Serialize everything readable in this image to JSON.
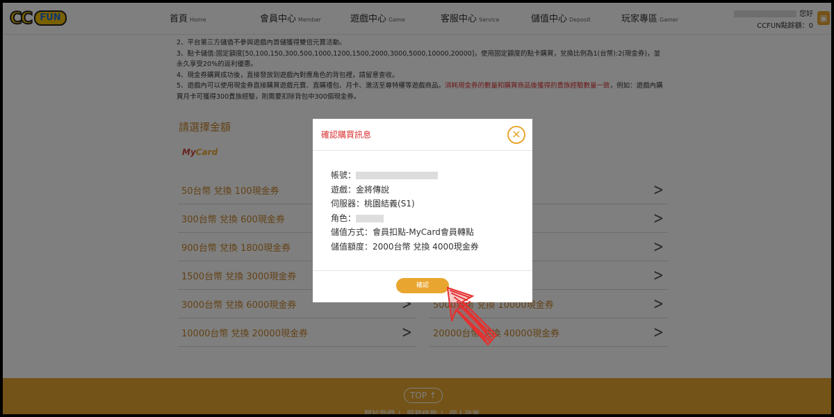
{
  "header": {
    "logo_cc": "CC",
    "logo_fun": "FUN",
    "nav": [
      {
        "zh": "首頁",
        "en": "Home"
      },
      {
        "zh": "會員中心",
        "en": "Member"
      },
      {
        "zh": "遊戲中心",
        "en": "Game"
      },
      {
        "zh": "客服中心",
        "en": "Service"
      },
      {
        "zh": "儲值中心",
        "en": "Deposit"
      },
      {
        "zh": "玩家專區",
        "en": "Gamer"
      }
    ],
    "greeting": "您好",
    "points": "CCFUN點餘額：0"
  },
  "notes": {
    "line2": "2、平台第三方儲值不參與遊戲內首儲獲得雙倍元寶活動。",
    "line3": "3、點卡儲值:固定額度[50,100,150,300,500,1000,1200,1500,2000,3000,5000,10000,20000]，使用固定額度的點卡購買，兌換比例為1(台幣):2(現金券)，並永久享受20%的返利優惠。",
    "line4": "4、現金券購買成功後，直接發放到遊戲內對應角色的背包裡，請留意查收。",
    "line5a": "5、遊戲內可以使用現金券直接購買遊戲元寶、直購禮包、月卡、激活至尊特權等遊戲商品。",
    "line5red": "消耗現金券的數量和購買商品後獲得的貴族經驗數量一致",
    "line5b": "，例如：遊戲內購買月卡可獲得300貴族經驗，則需要扣除背包中300個現金券。"
  },
  "section_title": "請選擇金額",
  "mycard_logo": {
    "a": "My",
    "b": "Card"
  },
  "options_left": [
    "50台幣 兌換 100現金券",
    "300台幣 兌換 600現金券",
    "900台幣 兌換 1800現金券",
    "1500台幣 兌換 3000現金券",
    "3000台幣 兌換 6000現金券",
    "10000台幣 兌換 20000現金券"
  ],
  "options_right": [
    "",
    "",
    "",
    "",
    "5000台幣 兌換 10000現金券",
    "20000台幣 兌換 40000現金券"
  ],
  "modal": {
    "title": "確認購買訊息",
    "close": "✕",
    "account_label": "帳號：",
    "game_label": "遊戲：",
    "game_value": "金將傳說",
    "server_label": "伺服器：",
    "server_value": "桃園結義(S1)",
    "role_label": "角色：",
    "method_label": "儲值方式：",
    "method_value": "會員扣點-MyCard會員轉點",
    "amount_label": "儲值額度：",
    "amount_value": "2000台幣 兌換 4000現金券",
    "confirm": "確認"
  },
  "footer": {
    "top": "TOP ↑",
    "links": [
      "關於我們",
      "服務條款",
      "個人政策"
    ]
  },
  "colors": {
    "accent": "#e8a630",
    "title_red": "#d93030",
    "option_text": "#c7852c"
  }
}
